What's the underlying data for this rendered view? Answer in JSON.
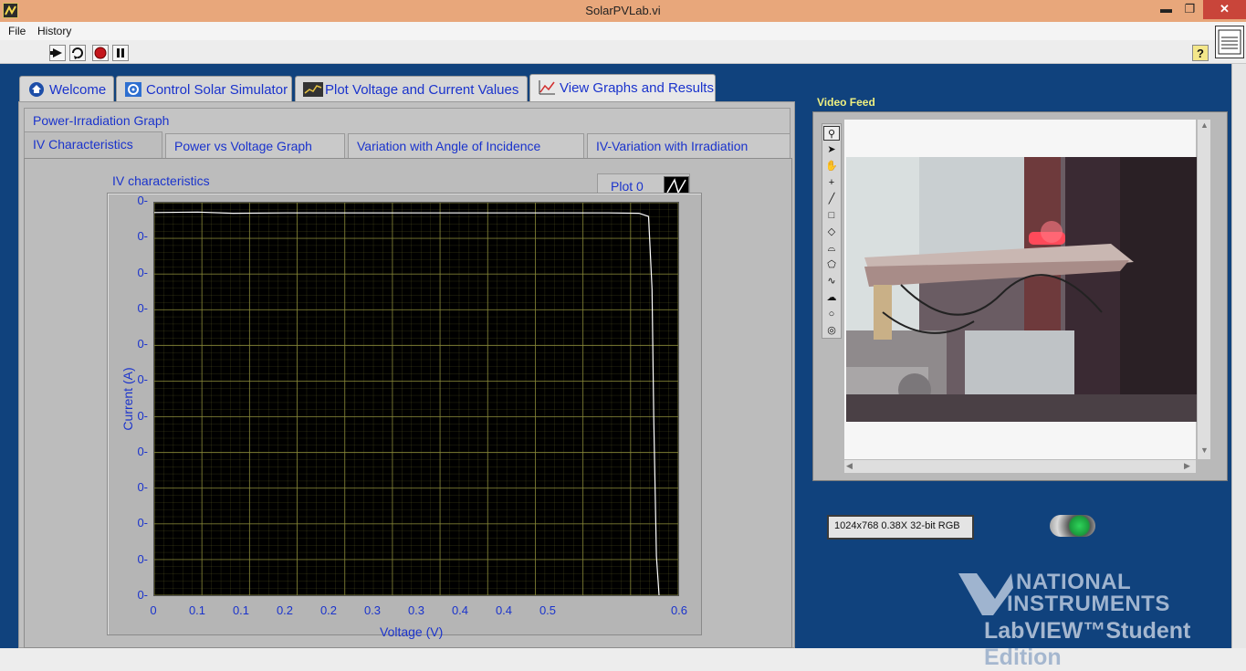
{
  "window": {
    "title": "SolarPVLab.vi",
    "controls": {
      "minimize": "▬",
      "restore": "❐",
      "close": "✕"
    }
  },
  "menu": {
    "items": [
      "File",
      "History"
    ]
  },
  "toolbar": {
    "buttons": [
      "run-arrow-icon",
      "run-continuous-icon",
      "abort-icon",
      "pause-icon"
    ],
    "help": "?"
  },
  "outer_tabs": [
    {
      "label": "Welcome",
      "icon": "home-icon",
      "selected": false
    },
    {
      "label": "Control Solar Simulator",
      "icon": "gear-icon",
      "selected": false
    },
    {
      "label": "Plot Voltage and Current Values",
      "icon": "waveform-icon",
      "selected": false
    },
    {
      "label": "View Graphs and Results",
      "icon": "graph-icon",
      "selected": true
    }
  ],
  "inner_tabs": {
    "row1": [
      {
        "label": "Power-Irradiation Graph"
      }
    ],
    "row2": [
      {
        "label": "IV Characteristics",
        "selected": true
      },
      {
        "label": "Power vs Voltage Graph"
      },
      {
        "label": "Variation with Angle of Incidence"
      },
      {
        "label": "IV-Variation with Irradiation"
      }
    ]
  },
  "graph": {
    "title": "IV characteristics",
    "legend_label": "Plot 0"
  },
  "chart_data": {
    "type": "line",
    "title": "IV characteristics",
    "xlabel": "Voltage (V)",
    "ylabel": "Current (A)",
    "xlim": [
      0,
      0.6
    ],
    "x_ticks": [
      "0",
      "0.1",
      "0.1",
      "0.2",
      "0.2",
      "0.3",
      "0.3",
      "0.4",
      "0.4",
      "0.5",
      "0.6"
    ],
    "y_ticks": [
      "0",
      "0",
      "0",
      "0",
      "0",
      "0",
      "0",
      "0",
      "0",
      "0",
      "0",
      "0"
    ],
    "grid": true,
    "grid_color": "#8a8a3a",
    "background": "#000000",
    "series": [
      {
        "name": "Plot 0",
        "color": "#ffffff",
        "points": [
          [
            0.0,
            0.975
          ],
          [
            0.05,
            0.976
          ],
          [
            0.09,
            0.973
          ],
          [
            0.15,
            0.974
          ],
          [
            0.27,
            0.974
          ],
          [
            0.43,
            0.974
          ],
          [
            0.52,
            0.974
          ],
          [
            0.555,
            0.973
          ],
          [
            0.566,
            0.965
          ],
          [
            0.57,
            0.78
          ],
          [
            0.572,
            0.45
          ],
          [
            0.575,
            0.1
          ],
          [
            0.578,
            0.0
          ]
        ]
      }
    ]
  },
  "video": {
    "label": "Video Feed",
    "tools": [
      "zoom-icon",
      "pointer-icon",
      "pan-icon",
      "crosshair-icon",
      "line-icon",
      "rectangle-icon",
      "rotated-rect-icon",
      "annulus-icon",
      "polygon-icon",
      "freehand-icon",
      "free-region-icon",
      "oval-icon",
      "ring-icon"
    ],
    "image_info": "1024x768 0.38X 32-bit RGB"
  },
  "branding": {
    "line1": "NATIONAL",
    "line2": "INSTRUMENTS",
    "line3": "LabVIEW™Student Edition"
  }
}
